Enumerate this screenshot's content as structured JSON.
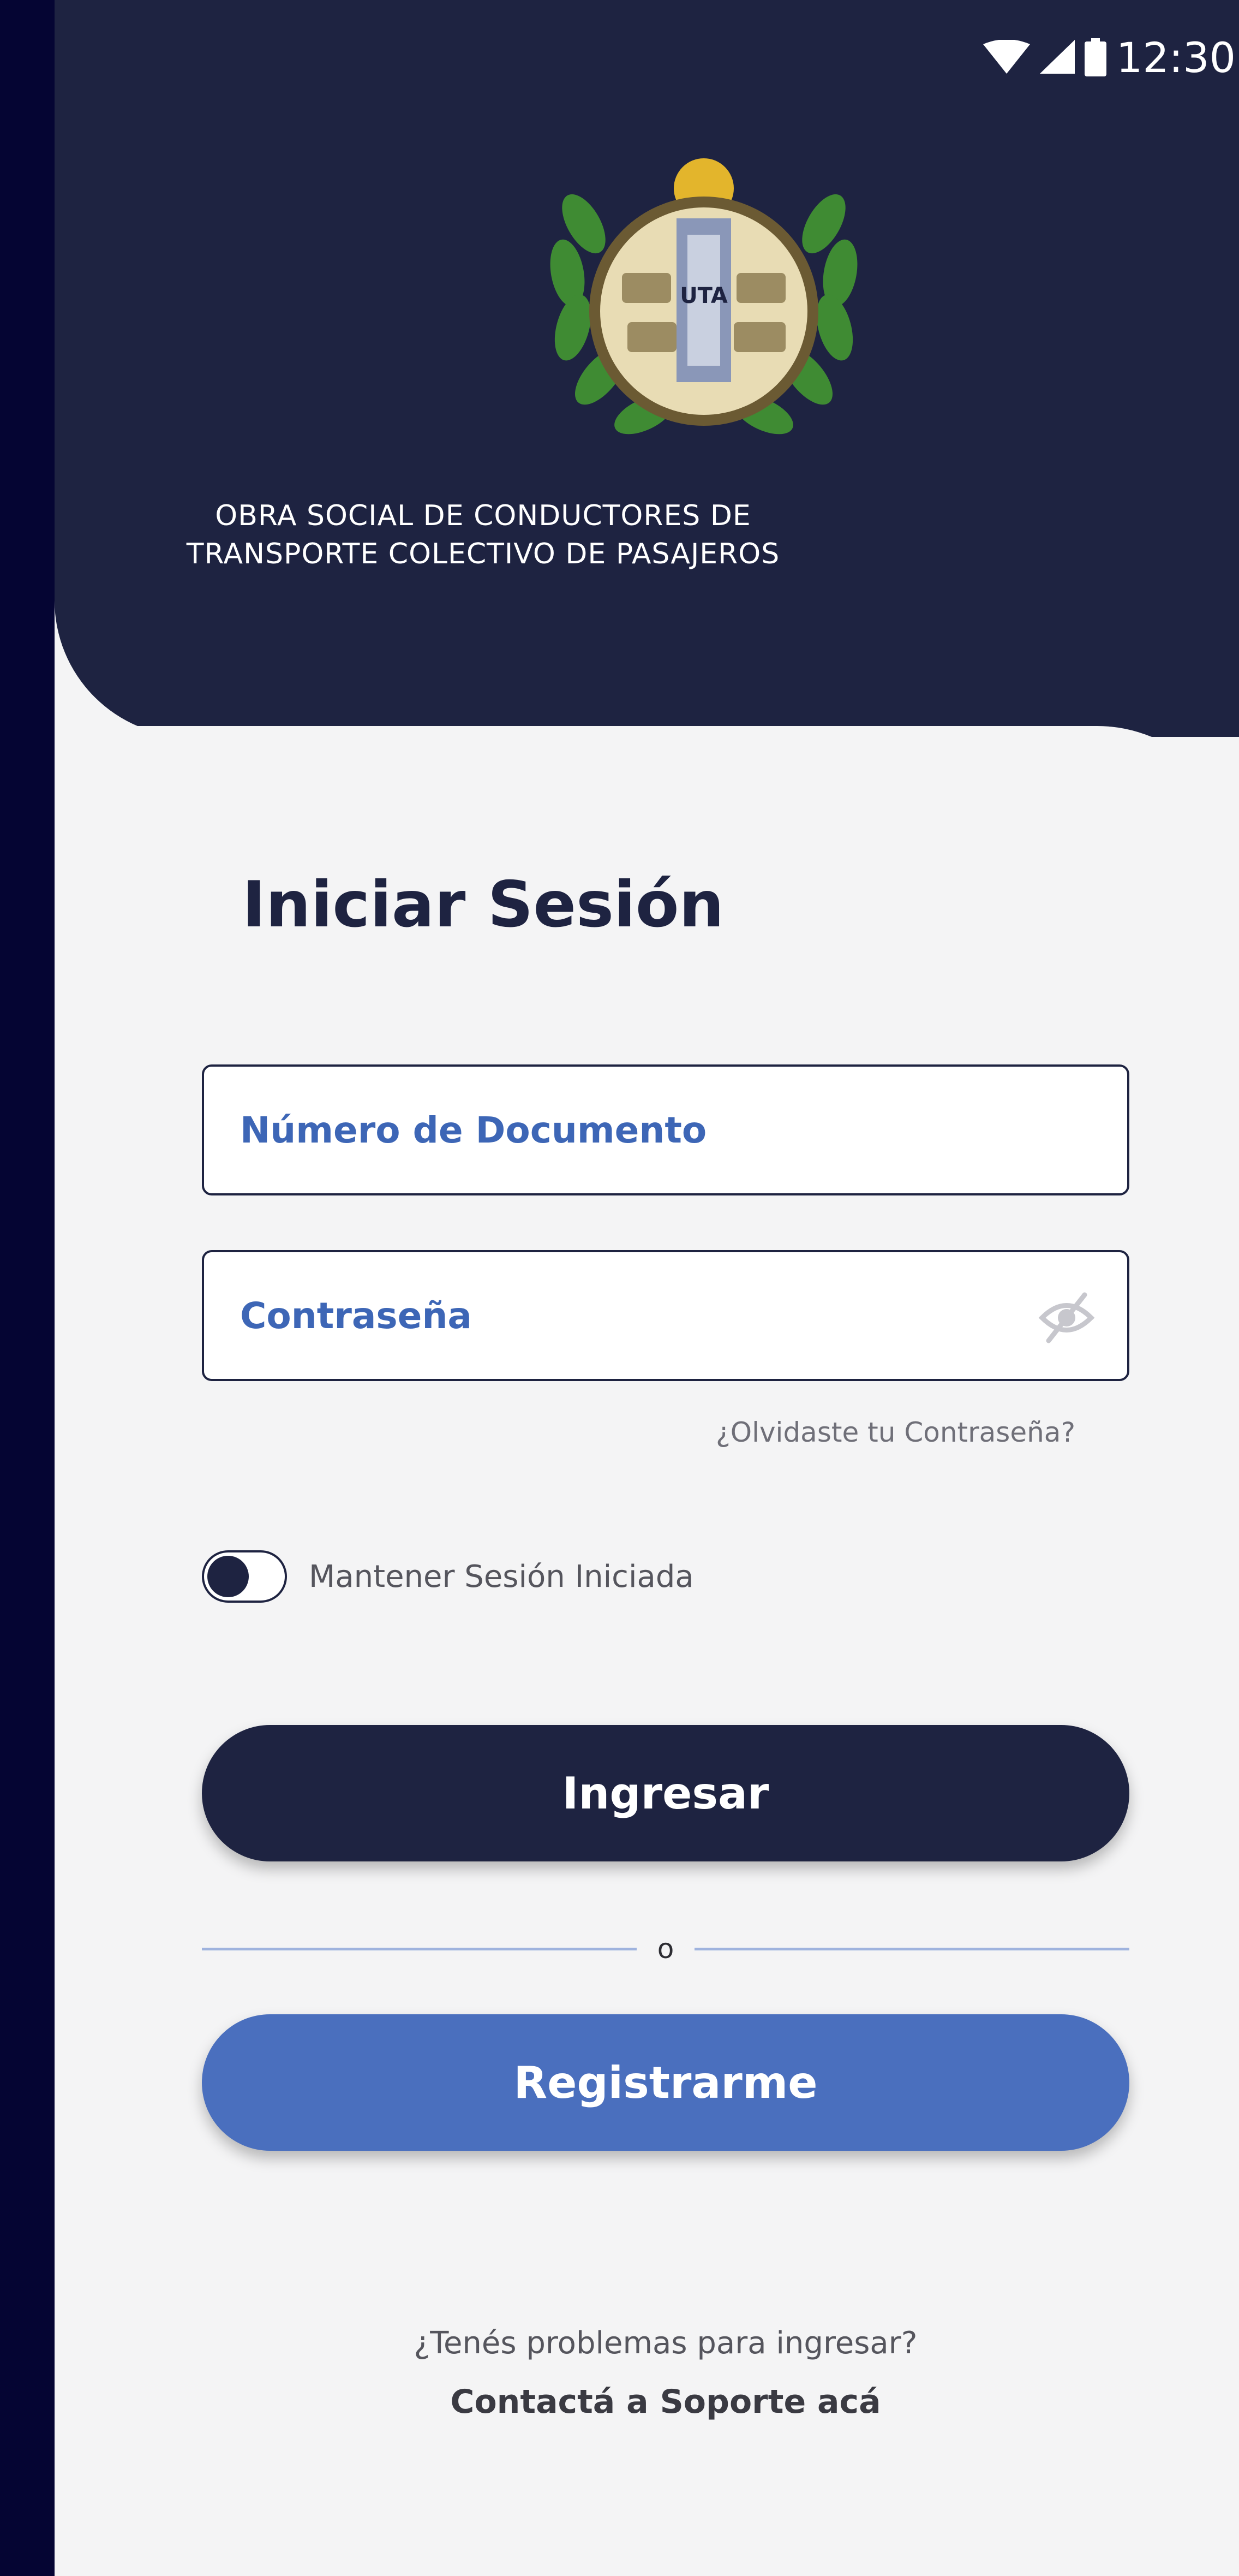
{
  "status_bar": {
    "time": "12:30",
    "icons": [
      "wifi-icon",
      "signal-icon",
      "battery-icon"
    ]
  },
  "header": {
    "logo": "uta-seal-logo",
    "logo_text": "UTA",
    "org_line1": "OBRA SOCIAL DE CONDUCTORES DE",
    "org_line2": "TRANSPORTE COLECTIVO DE PASAJEROS"
  },
  "form": {
    "title": "Iniciar Sesión",
    "document_placeholder": "Número de Documento",
    "password_placeholder": "Contraseña",
    "password_visibility_icon": "eye-off-icon",
    "forgot_password": "¿Olvidaste tu Contraseña?",
    "keep_session_label": "Mantener Sesión Iniciada",
    "keep_session_on": false,
    "login_button": "Ingresar",
    "divider_text": "o",
    "register_button": "Registrarme"
  },
  "footer": {
    "help_question": "¿Tenés problemas para ingresar?",
    "support_link": "Contactá a Soporte acá"
  },
  "colors": {
    "background": "#050533",
    "header": "#1e2341",
    "primary": "#1e2341",
    "secondary": "#4a6fbe",
    "input_text": "#3d66b6",
    "page": "#f4f4f5"
  }
}
